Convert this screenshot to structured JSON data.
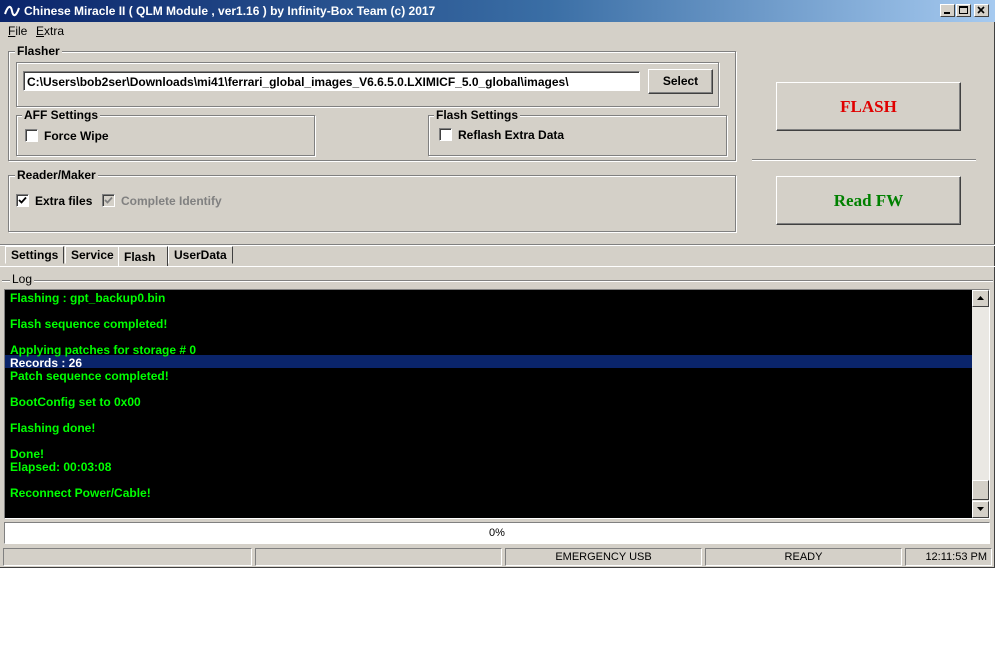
{
  "window": {
    "title": "Chinese Miracle II ( QLM Module , ver1.16  ) by Infinity-Box Team (c) 2017"
  },
  "menu": {
    "file": {
      "accel": "F",
      "rest": "ile"
    },
    "extra": {
      "accel": "E",
      "rest": "xtra"
    }
  },
  "flasher": {
    "label": "Flasher",
    "path": "C:\\Users\\bob2ser\\Downloads\\mi41\\ferrari_global_images_V6.6.5.0.LXIMICF_5.0_global\\images\\",
    "select_label": "Select",
    "aff_settings": {
      "label": "AFF Settings",
      "force_wipe": {
        "label": "Force Wipe",
        "checked": false
      }
    },
    "flash_settings": {
      "label": "Flash Settings",
      "reflash_extra": {
        "label": "Reflash Extra Data",
        "checked": false
      }
    }
  },
  "reader_maker": {
    "label": "Reader/Maker",
    "extra_files": {
      "label": "Extra files",
      "checked": true
    },
    "complete_identify": {
      "label": "Complete Identify",
      "checked": true,
      "disabled": true
    }
  },
  "buttons": {
    "flash": {
      "label": "FLASH",
      "color": "#e00000"
    },
    "read_fw": {
      "label": "Read FW",
      "color": "#008000"
    }
  },
  "tabs": [
    {
      "label": "Settings",
      "active": false
    },
    {
      "label": "Service",
      "active": false
    },
    {
      "label": "Flash",
      "active": true
    },
    {
      "label": "UserData",
      "active": false
    }
  ],
  "log": {
    "label": "Log",
    "text_color": "#00ff00",
    "lines": [
      "Flashing : gpt_backup0.bin",
      "",
      "Flash sequence completed!",
      "",
      "Applying patches for storage # 0",
      "Records : 26",
      "Patch sequence completed!",
      "",
      "BootConfig set to 0x00",
      "",
      "Flashing done!",
      "",
      "Done!",
      "Elapsed: 00:03:08",
      "",
      "Reconnect Power/Cable!"
    ],
    "selected_line": 5
  },
  "progress": {
    "text": "0%",
    "value": 0
  },
  "status": {
    "panel3": "EMERGENCY USB",
    "panel4": "READY",
    "time": "12:11:53 PM"
  }
}
